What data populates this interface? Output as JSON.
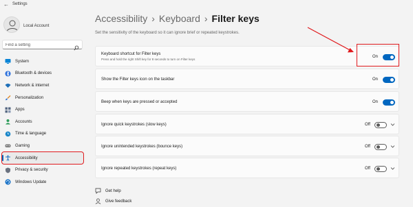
{
  "window": {
    "title": "Settings",
    "back_icon": "back-arrow-icon"
  },
  "account": {
    "name": "Local Account",
    "avatar_icon": "person-icon"
  },
  "search": {
    "placeholder": "Find a setting",
    "icon": "search-icon"
  },
  "sidebar": {
    "items": [
      {
        "label": "System",
        "icon": "monitor-icon",
        "active": false
      },
      {
        "label": "Bluetooth & devices",
        "icon": "bluetooth-icon",
        "active": false
      },
      {
        "label": "Network & internet",
        "icon": "wifi-icon",
        "active": false
      },
      {
        "label": "Personalization",
        "icon": "brush-icon",
        "active": false
      },
      {
        "label": "Apps",
        "icon": "apps-icon",
        "active": false
      },
      {
        "label": "Accounts",
        "icon": "person-icon",
        "active": false
      },
      {
        "label": "Time & language",
        "icon": "globe-clock-icon",
        "active": false
      },
      {
        "label": "Gaming",
        "icon": "gamepad-icon",
        "active": false
      },
      {
        "label": "Accessibility",
        "icon": "accessibility-icon",
        "active": true
      },
      {
        "label": "Privacy & security",
        "icon": "shield-icon",
        "active": false
      },
      {
        "label": "Windows Update",
        "icon": "update-icon",
        "active": false
      }
    ]
  },
  "header": {
    "breadcrumb": [
      "Accessibility",
      "Keyboard"
    ],
    "current": "Filter keys",
    "separator": "›",
    "subtitle": "Set the sensitivity of the keyboard so it can ignore brief or repeated keystrokes."
  },
  "settings": [
    {
      "title": "Keyboard shortcut for Filter keys",
      "description": "Press and hold the right Shift key for 8 seconds to turn on Filter keys",
      "state": "On",
      "on": true,
      "expandable": false
    },
    {
      "title": "Show the Filter keys icon on the taskbar",
      "description": "",
      "state": "On",
      "on": true,
      "expandable": false
    },
    {
      "title": "Beep when keys are pressed or accepted",
      "description": "",
      "state": "On",
      "on": true,
      "expandable": false
    },
    {
      "title": "Ignore quick keystrokes (slow keys)",
      "description": "",
      "state": "Off",
      "on": false,
      "expandable": true
    },
    {
      "title": "Ignore unintended keystrokes (bounce keys)",
      "description": "",
      "state": "Off",
      "on": false,
      "expandable": true
    },
    {
      "title": "Ignore repeated keystrokes (repeat keys)",
      "description": "",
      "state": "Off",
      "on": false,
      "expandable": true
    }
  ],
  "footer": {
    "links": [
      {
        "label": "Get help",
        "icon": "help-icon"
      },
      {
        "label": "Give feedback",
        "icon": "feedback-icon"
      }
    ]
  },
  "colors": {
    "accent": "#0067c0",
    "annotation": "#e0191c",
    "background": "#f3f3f3"
  }
}
